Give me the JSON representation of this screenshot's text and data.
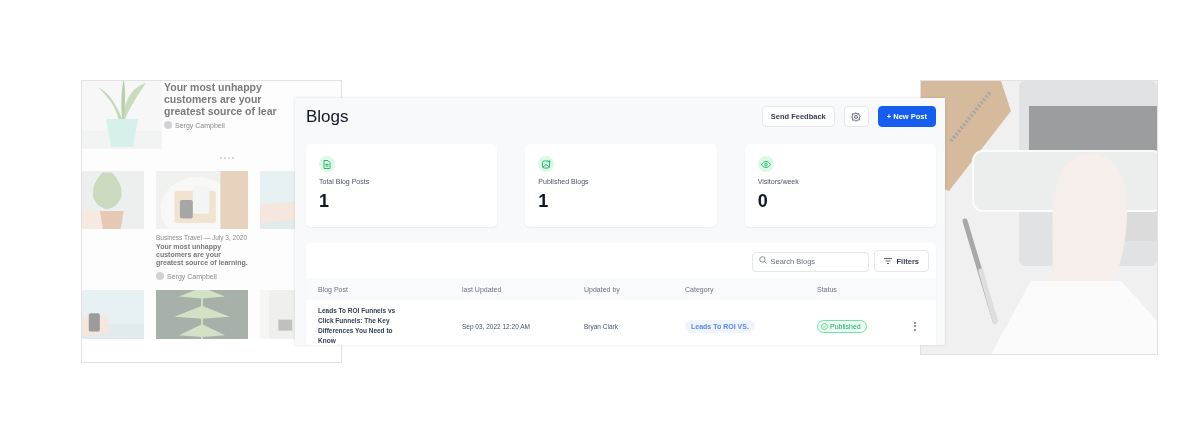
{
  "website_preview": {
    "headline": "Your most unhappy customers are your greatest source of lear",
    "author": "Sergy Campbell",
    "card": {
      "category": "Business Travel — July 3, 2020",
      "title": "Your most unhappy customers are your greatest source of learning.",
      "author": "Sergy Campbell"
    }
  },
  "header": {
    "title": "Blogs",
    "buttons": [
      {
        "kind": "outline",
        "label": "Send Feedback"
      },
      {
        "kind": "settings"
      },
      {
        "kind": "primary",
        "label": "+ New Post"
      }
    ]
  },
  "stats": [
    {
      "label": "Total Blog Posts",
      "value": "1"
    },
    {
      "label": "Published Blogs",
      "value": "1"
    },
    {
      "label": "Visitors/week",
      "value": "0"
    }
  ],
  "table": {
    "search": {
      "placeholder": "Search Blogs"
    },
    "filter_button": "Filters",
    "columns": [
      "Blog Post",
      "last Updated",
      "Updated by",
      "Category",
      "Status"
    ],
    "rows": [
      {
        "title": "Leads To ROI Funnels vs Click Funnels: The Key Differences You Need to Know",
        "last_updated": "Sep 03, 2022 12:20 AM",
        "updated_by": "Bryan Clark",
        "category": "Leads To ROI VS.",
        "status": "Published"
      }
    ]
  }
}
